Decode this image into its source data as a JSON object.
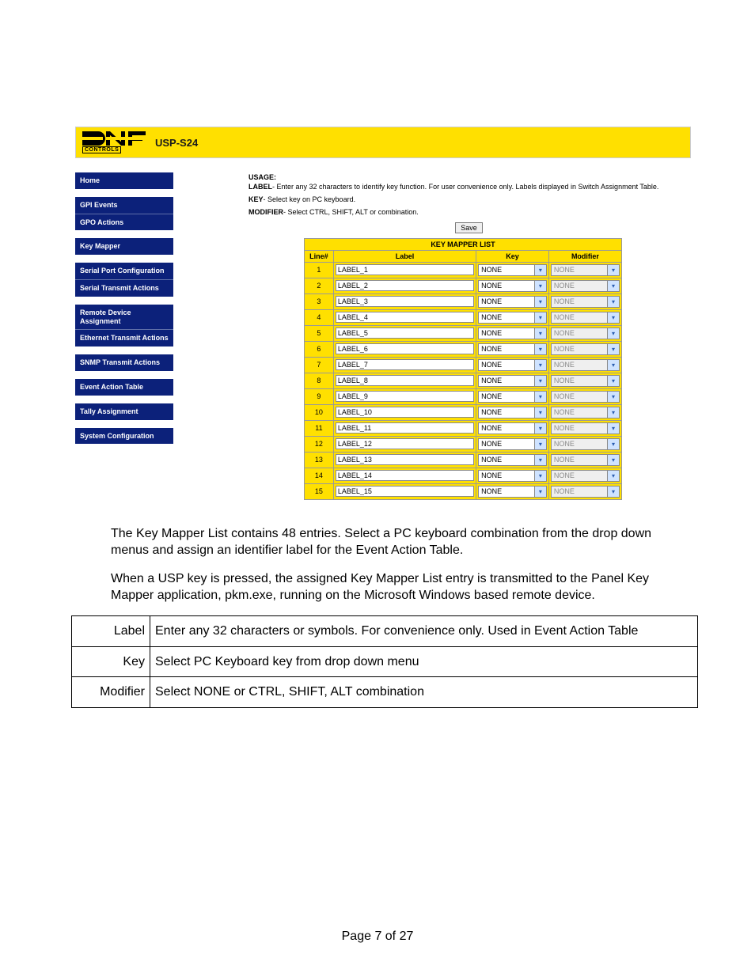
{
  "banner": {
    "product": "USP-S24",
    "logo_sub": "CONTROLS"
  },
  "sidebar": {
    "groups": [
      {
        "items": [
          {
            "label": "Home"
          }
        ]
      },
      {
        "items": [
          {
            "label": "GPI Events"
          },
          {
            "label": "GPO Actions"
          }
        ]
      },
      {
        "items": [
          {
            "label": "Key Mapper"
          }
        ]
      },
      {
        "items": [
          {
            "label": "Serial Port Configuration"
          },
          {
            "label": "Serial Transmit Actions"
          }
        ]
      },
      {
        "items": [
          {
            "label": "Remote Device Assignment"
          },
          {
            "label": "Ethernet Transmit Actions"
          }
        ]
      },
      {
        "items": [
          {
            "label": "SNMP Transmit Actions"
          }
        ]
      },
      {
        "items": [
          {
            "label": "Event Action Table"
          }
        ]
      },
      {
        "items": [
          {
            "label": "Tally Assignment"
          }
        ]
      },
      {
        "items": [
          {
            "label": "System Configuration"
          }
        ]
      }
    ]
  },
  "usage": {
    "heading": "USAGE:",
    "label_key": "LABEL",
    "label_text": "- Enter any 32 characters to identify key function. For user convenience only. Labels displayed in Switch Assignment Table.",
    "key_key": "KEY",
    "key_text": "- Select key on PC keyboard.",
    "mod_key": "MODIFIER",
    "mod_text": "- Select CTRL, SHIFT, ALT or combination."
  },
  "save_btn": "Save",
  "km": {
    "title": "KEY MAPPER LIST",
    "cols": {
      "line": "Line#",
      "label": "Label",
      "key": "Key",
      "modifier": "Modifier"
    },
    "total_entries": 48,
    "rows": [
      {
        "n": "1",
        "label": "LABEL_1",
        "key": "NONE",
        "mod": "NONE"
      },
      {
        "n": "2",
        "label": "LABEL_2",
        "key": "NONE",
        "mod": "NONE"
      },
      {
        "n": "3",
        "label": "LABEL_3",
        "key": "NONE",
        "mod": "NONE"
      },
      {
        "n": "4",
        "label": "LABEL_4",
        "key": "NONE",
        "mod": "NONE"
      },
      {
        "n": "5",
        "label": "LABEL_5",
        "key": "NONE",
        "mod": "NONE"
      },
      {
        "n": "6",
        "label": "LABEL_6",
        "key": "NONE",
        "mod": "NONE"
      },
      {
        "n": "7",
        "label": "LABEL_7",
        "key": "NONE",
        "mod": "NONE"
      },
      {
        "n": "8",
        "label": "LABEL_8",
        "key": "NONE",
        "mod": "NONE"
      },
      {
        "n": "9",
        "label": "LABEL_9",
        "key": "NONE",
        "mod": "NONE"
      },
      {
        "n": "10",
        "label": "LABEL_10",
        "key": "NONE",
        "mod": "NONE"
      },
      {
        "n": "11",
        "label": "LABEL_11",
        "key": "NONE",
        "mod": "NONE"
      },
      {
        "n": "12",
        "label": "LABEL_12",
        "key": "NONE",
        "mod": "NONE"
      },
      {
        "n": "13",
        "label": "LABEL_13",
        "key": "NONE",
        "mod": "NONE"
      },
      {
        "n": "14",
        "label": "LABEL_14",
        "key": "NONE",
        "mod": "NONE"
      },
      {
        "n": "15",
        "label": "LABEL_15",
        "key": "NONE",
        "mod": "NONE"
      }
    ]
  },
  "body": {
    "p1": "The Key Mapper List contains 48 entries.  Select a PC keyboard combination from the drop down menus and assign an identifier label for the Event Action Table.",
    "p2": "When a USP key is pressed, the assigned Key Mapper List entry is transmitted to the Panel Key Mapper application, pkm.exe, running on the Microsoft Windows based remote device.",
    "defs": [
      {
        "k": "Label",
        "v": "Enter any 32 characters or symbols.  For convenience only.  Used in Event Action Table"
      },
      {
        "k": "Key",
        "v": "Select PC Keyboard key from drop down menu"
      },
      {
        "k": "Modifier",
        "v": "Select NONE or CTRL, SHIFT, ALT combination"
      }
    ]
  },
  "footer": "Page 7 of 27"
}
